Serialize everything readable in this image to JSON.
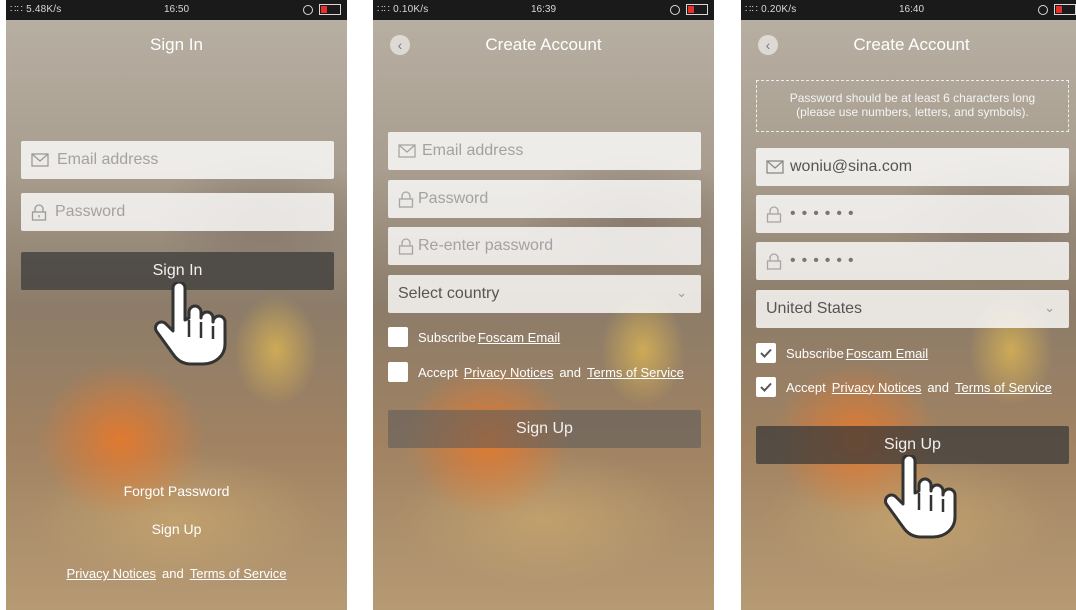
{
  "screens": [
    {
      "status": {
        "signal": "∷∷ 5.48K/s",
        "time": "16:50"
      },
      "title": "Sign In",
      "email_placeholder": "Email address",
      "password_placeholder": "Password",
      "sign_in_label": "Sign In",
      "forgot_label": "Forgot Password",
      "sign_up_label": "Sign Up",
      "legal": {
        "privacy": "Privacy Notices",
        "and": "and",
        "terms": "Terms of Service"
      }
    },
    {
      "status": {
        "signal": "∷∷ 0.10K/s",
        "time": "16:39"
      },
      "title": "Create Account",
      "email_placeholder": "Email address",
      "password_placeholder": "Password",
      "reenter_placeholder": "Re-enter password",
      "country_placeholder": "Select country",
      "subscribe": {
        "text": "Subscribe",
        "link": "Foscam Email"
      },
      "accept": {
        "text": "Accept",
        "privacy": "Privacy Notices",
        "and": "and",
        "terms": "Terms of Service"
      },
      "sign_up_label": "Sign Up"
    },
    {
      "status": {
        "signal": "∷∷ 0.20K/s",
        "time": "16:40"
      },
      "title": "Create Account",
      "notice_line1": "Password should be at least 6 characters long",
      "notice_line2": "(please use numbers, letters, and symbols).",
      "email_value": "woniu@sina.com",
      "password_value": "••••••",
      "reenter_value": "••••••",
      "country_value": "United States",
      "subscribe": {
        "text": "Subscribe",
        "link": "Foscam Email"
      },
      "accept": {
        "text": "Accept",
        "privacy": "Privacy Notices",
        "and": "and",
        "terms": "Terms of Service"
      },
      "sign_up_label": "Sign Up"
    }
  ],
  "icons": {
    "email": "envelope-icon",
    "lock": "lock-icon",
    "check": "checkmark-icon",
    "back": "back-arrow-icon",
    "dropdown": "chevron-down-icon",
    "hand": "pointing-hand-icon"
  },
  "colors": {
    "status_bar": "#1a1a1a",
    "button_bg": "#373737",
    "field_bg": "#ffffff",
    "battery_low": "#e0322b"
  }
}
